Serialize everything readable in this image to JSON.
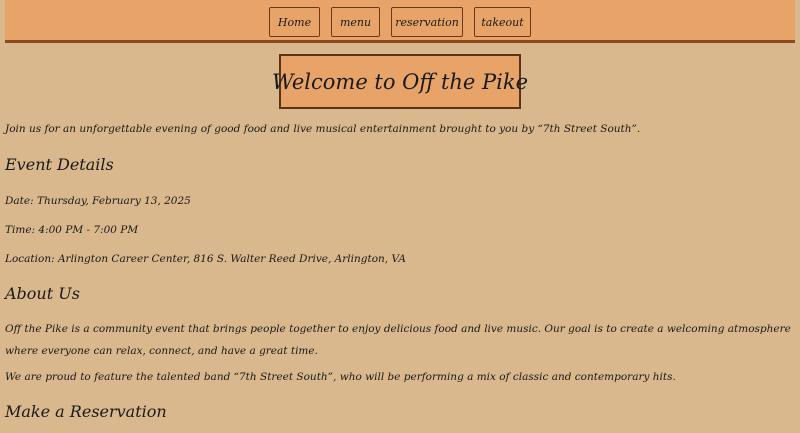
{
  "nav": {
    "home": "Home",
    "menu": "menu",
    "reservation": "reservation",
    "takeout": "takeout"
  },
  "title": "Welcome to Off the Pike",
  "intro": "Join us for an unforgettable evening of good food and live musical entertainment brought to you by “7th Street South”.",
  "event": {
    "heading": "Event Details",
    "date": "Date: Thursday, February 13, 2025",
    "time": "Time: 4:00 PM - 7:00 PM",
    "location": "Location: Arlington Career Center, 816 S. Walter Reed Drive, Arlington, VA"
  },
  "about": {
    "heading": "About Us",
    "para1": "Off the Pike is a community event that brings people together to enjoy delicious food and live music. Our goal is to create a welcoming atmosphere where everyone can relax, connect, and have a great time.",
    "para2": "We are proud to feature the talented band “7th Street South”, who will be performing a mix of classic and contemporary hits."
  },
  "reservation": {
    "heading": "Make a Reservation"
  },
  "colors": {
    "background": "#d8b88c",
    "accent": "#e8a468",
    "border": "#8a4a1c"
  }
}
